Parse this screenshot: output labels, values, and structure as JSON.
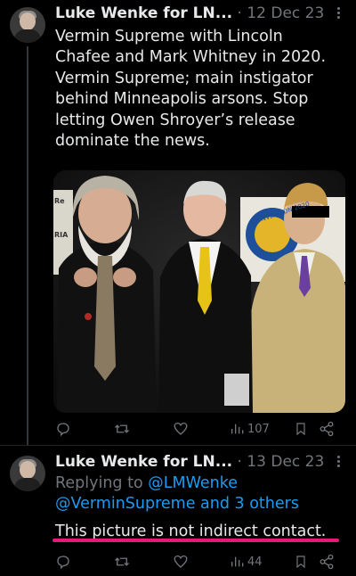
{
  "tweets": [
    {
      "author": "Luke Wenke for LN...",
      "separator": " · ",
      "date": "12 Dec 23",
      "text_lines": [
        "Vermin Supreme with Lincoln",
        "Chafee and Mark Whitney in 2020.",
        "Vermin Supreme; main instigator",
        "behind Minneapolis arsons.  Stop",
        "letting Owen Shroyer’s release",
        "dominate the news."
      ],
      "photo": {
        "banner_text": "CONVENTION 2020",
        "left_sign": "RIA",
        "corner_sign": "Re"
      },
      "actions": {
        "views": "107"
      }
    },
    {
      "author": "Luke Wenke for LN...",
      "separator": " · ",
      "date": "13 Dec 23",
      "replying_prefix": "Replying to ",
      "replying_handle": "@LMWenke",
      "replying_line2_handle": "@VerminSupreme",
      "replying_line2_suffix": " and 3 others",
      "text": "This picture is not indirect contact.",
      "highlight_color": "#e21b7a",
      "actions": {
        "views": "44"
      }
    }
  ],
  "colors": {
    "background": "#000000",
    "text": "#e7e9ea",
    "muted": "#71767b",
    "link": "#1d9bf0"
  },
  "icons": [
    "reply-icon",
    "retweet-icon",
    "like-icon",
    "views-icon",
    "bookmark-icon",
    "share-icon",
    "more-icon"
  ]
}
